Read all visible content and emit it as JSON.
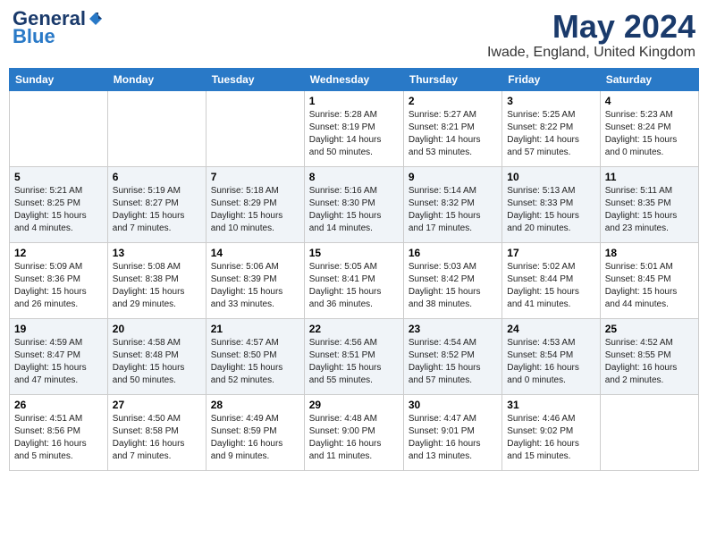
{
  "logo": {
    "general": "General",
    "blue": "Blue"
  },
  "header": {
    "month": "May 2024",
    "location": "Iwade, England, United Kingdom"
  },
  "weekdays": [
    "Sunday",
    "Monday",
    "Tuesday",
    "Wednesday",
    "Thursday",
    "Friday",
    "Saturday"
  ],
  "weeks": [
    [
      {
        "day": "",
        "info": ""
      },
      {
        "day": "",
        "info": ""
      },
      {
        "day": "",
        "info": ""
      },
      {
        "day": "1",
        "info": "Sunrise: 5:28 AM\nSunset: 8:19 PM\nDaylight: 14 hours\nand 50 minutes."
      },
      {
        "day": "2",
        "info": "Sunrise: 5:27 AM\nSunset: 8:21 PM\nDaylight: 14 hours\nand 53 minutes."
      },
      {
        "day": "3",
        "info": "Sunrise: 5:25 AM\nSunset: 8:22 PM\nDaylight: 14 hours\nand 57 minutes."
      },
      {
        "day": "4",
        "info": "Sunrise: 5:23 AM\nSunset: 8:24 PM\nDaylight: 15 hours\nand 0 minutes."
      }
    ],
    [
      {
        "day": "5",
        "info": "Sunrise: 5:21 AM\nSunset: 8:25 PM\nDaylight: 15 hours\nand 4 minutes."
      },
      {
        "day": "6",
        "info": "Sunrise: 5:19 AM\nSunset: 8:27 PM\nDaylight: 15 hours\nand 7 minutes."
      },
      {
        "day": "7",
        "info": "Sunrise: 5:18 AM\nSunset: 8:29 PM\nDaylight: 15 hours\nand 10 minutes."
      },
      {
        "day": "8",
        "info": "Sunrise: 5:16 AM\nSunset: 8:30 PM\nDaylight: 15 hours\nand 14 minutes."
      },
      {
        "day": "9",
        "info": "Sunrise: 5:14 AM\nSunset: 8:32 PM\nDaylight: 15 hours\nand 17 minutes."
      },
      {
        "day": "10",
        "info": "Sunrise: 5:13 AM\nSunset: 8:33 PM\nDaylight: 15 hours\nand 20 minutes."
      },
      {
        "day": "11",
        "info": "Sunrise: 5:11 AM\nSunset: 8:35 PM\nDaylight: 15 hours\nand 23 minutes."
      }
    ],
    [
      {
        "day": "12",
        "info": "Sunrise: 5:09 AM\nSunset: 8:36 PM\nDaylight: 15 hours\nand 26 minutes."
      },
      {
        "day": "13",
        "info": "Sunrise: 5:08 AM\nSunset: 8:38 PM\nDaylight: 15 hours\nand 29 minutes."
      },
      {
        "day": "14",
        "info": "Sunrise: 5:06 AM\nSunset: 8:39 PM\nDaylight: 15 hours\nand 33 minutes."
      },
      {
        "day": "15",
        "info": "Sunrise: 5:05 AM\nSunset: 8:41 PM\nDaylight: 15 hours\nand 36 minutes."
      },
      {
        "day": "16",
        "info": "Sunrise: 5:03 AM\nSunset: 8:42 PM\nDaylight: 15 hours\nand 38 minutes."
      },
      {
        "day": "17",
        "info": "Sunrise: 5:02 AM\nSunset: 8:44 PM\nDaylight: 15 hours\nand 41 minutes."
      },
      {
        "day": "18",
        "info": "Sunrise: 5:01 AM\nSunset: 8:45 PM\nDaylight: 15 hours\nand 44 minutes."
      }
    ],
    [
      {
        "day": "19",
        "info": "Sunrise: 4:59 AM\nSunset: 8:47 PM\nDaylight: 15 hours\nand 47 minutes."
      },
      {
        "day": "20",
        "info": "Sunrise: 4:58 AM\nSunset: 8:48 PM\nDaylight: 15 hours\nand 50 minutes."
      },
      {
        "day": "21",
        "info": "Sunrise: 4:57 AM\nSunset: 8:50 PM\nDaylight: 15 hours\nand 52 minutes."
      },
      {
        "day": "22",
        "info": "Sunrise: 4:56 AM\nSunset: 8:51 PM\nDaylight: 15 hours\nand 55 minutes."
      },
      {
        "day": "23",
        "info": "Sunrise: 4:54 AM\nSunset: 8:52 PM\nDaylight: 15 hours\nand 57 minutes."
      },
      {
        "day": "24",
        "info": "Sunrise: 4:53 AM\nSunset: 8:54 PM\nDaylight: 16 hours\nand 0 minutes."
      },
      {
        "day": "25",
        "info": "Sunrise: 4:52 AM\nSunset: 8:55 PM\nDaylight: 16 hours\nand 2 minutes."
      }
    ],
    [
      {
        "day": "26",
        "info": "Sunrise: 4:51 AM\nSunset: 8:56 PM\nDaylight: 16 hours\nand 5 minutes."
      },
      {
        "day": "27",
        "info": "Sunrise: 4:50 AM\nSunset: 8:58 PM\nDaylight: 16 hours\nand 7 minutes."
      },
      {
        "day": "28",
        "info": "Sunrise: 4:49 AM\nSunset: 8:59 PM\nDaylight: 16 hours\nand 9 minutes."
      },
      {
        "day": "29",
        "info": "Sunrise: 4:48 AM\nSunset: 9:00 PM\nDaylight: 16 hours\nand 11 minutes."
      },
      {
        "day": "30",
        "info": "Sunrise: 4:47 AM\nSunset: 9:01 PM\nDaylight: 16 hours\nand 13 minutes."
      },
      {
        "day": "31",
        "info": "Sunrise: 4:46 AM\nSunset: 9:02 PM\nDaylight: 16 hours\nand 15 minutes."
      },
      {
        "day": "",
        "info": ""
      }
    ]
  ]
}
